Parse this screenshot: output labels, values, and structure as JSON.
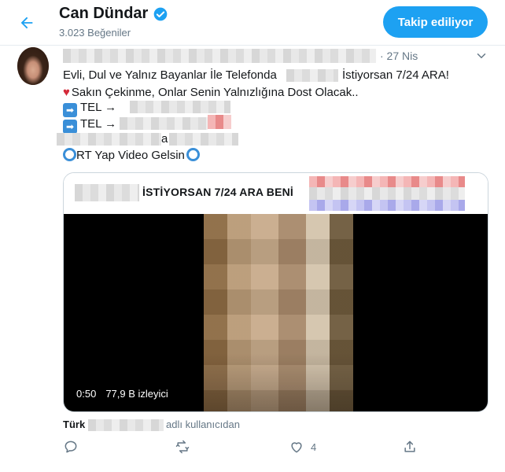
{
  "header": {
    "back_icon": "arrow-left-icon",
    "name": "Can Dündar",
    "verified_icon": "verified-badge-icon",
    "likes": "3.023 Beğeniler",
    "follow_label": "Takip ediliyor"
  },
  "tweet": {
    "time": "· 27 Nis",
    "line1_a": "Evli, Dul ve Yalnız Bayanlar İle Telefonda",
    "line1_b": "İstiyorsan 7/24 ARA!",
    "line2": "Sakın Çekinme, Onlar Senin Yalnızlığına Dost Olacak..",
    "tel1": "TEL →",
    "tel2": "TEL →",
    "line5": "a",
    "line6": "RT Yap Video Gelsin",
    "card_title": "İSTİYORSAN 7/24 ARA BENİ",
    "video_time": "0:50",
    "video_views": "77,9 B izleyici"
  },
  "source": {
    "lang": "Türk",
    "suffix": "adlı kullanıcıdan"
  },
  "actions": {
    "reply_icon": "reply-icon",
    "retweet_icon": "retweet-icon",
    "like_icon": "heart-icon",
    "like_count": "4",
    "share_icon": "share-icon"
  },
  "colors": {
    "accent": "#1da1f2",
    "muted": "#657786",
    "heart": "#d42a3a"
  }
}
